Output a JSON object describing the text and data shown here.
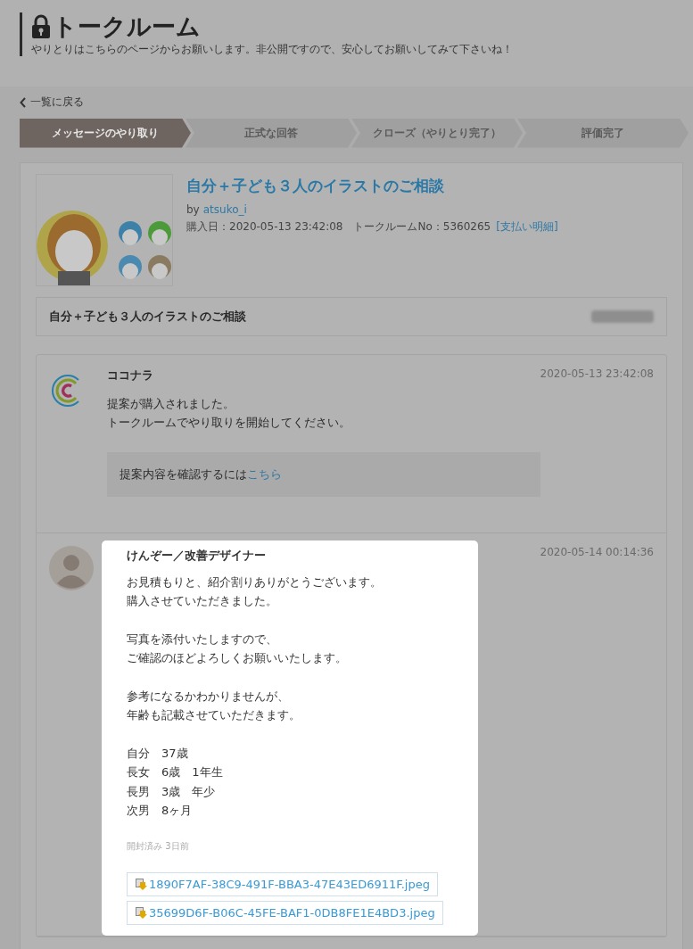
{
  "header": {
    "title": "トークルーム",
    "subtitle": "やりとりはこちらのページからお願いします。非公開ですので、安心してお願いしてみて下さいね！"
  },
  "back_link": "一覧に戻る",
  "steps": [
    {
      "label": "メッセージのやり取り",
      "selected": true
    },
    {
      "label": "正式な回答",
      "selected": false
    },
    {
      "label": "クローズ（やりとり完了）",
      "selected": false
    },
    {
      "label": "評価完了",
      "selected": false
    }
  ],
  "service": {
    "title": "自分＋子ども３人のイラストのご相談",
    "by": "by",
    "author": "atsuko_i",
    "meta": "購入日：2020-05-13 23:42:08　トークルームNo：5360265",
    "payment_link": "[支払い明細]"
  },
  "order": {
    "name": "自分＋子ども３人のイラストのご相談",
    "price_blurred": true
  },
  "messages": [
    {
      "kind": "system",
      "highlighted": false,
      "sender": "ココナラ",
      "time": "2020-05-13 23:42:08",
      "paragraphs": [
        [
          "提案が購入されました。",
          "トークルームでやり取りを開始してください。"
        ]
      ],
      "notice": "提案内容を確認するには",
      "notice_link": "こちら"
    },
    {
      "kind": "user",
      "highlighted": true,
      "sender": "けんぞー／改善デザイナー",
      "time": "2020-05-14 00:14:36",
      "paragraphs": [
        [
          "お見積もりと、紹介割りありがとうございます。",
          "購入させていただきました。"
        ],
        [
          "写真を添付いたしますので、",
          "ご確認のほどよろしくお願いいたします。"
        ],
        [
          "参考になるかわかりませんが、",
          "年齢も記載させていただきます。"
        ],
        [
          "自分　37歳",
          "長女　6歳　1年生",
          "長男　3歳　年少",
          "次男　8ヶ月"
        ]
      ],
      "read_status": "開封済み 3日前",
      "attachments": [
        "1890F7AF-38C9-491F-BBA3-47E43ED6911F.jpeg",
        "35699D6F-B06C-45FE-BAF1-0DB8FE1E4BD3.jpeg"
      ]
    }
  ]
}
